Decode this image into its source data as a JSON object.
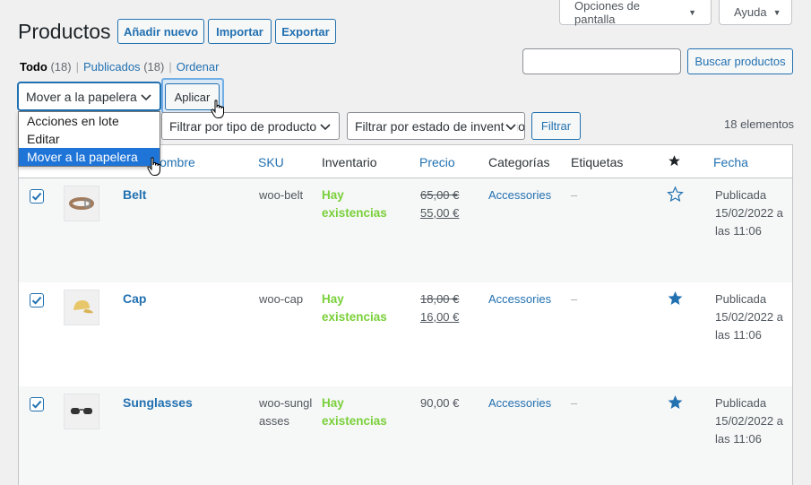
{
  "screen_options": {
    "label": "Opciones de pantalla"
  },
  "help": {
    "label": "Ayuda"
  },
  "page_title": "Productos",
  "title_actions": {
    "add_new": "Añadir nuevo",
    "import": "Importar",
    "export": "Exportar"
  },
  "views": {
    "all": "Todo",
    "all_count": "(18)",
    "published": "Publicados",
    "published_count": "(18)",
    "sort": "Ordenar",
    "sep": "|"
  },
  "search": {
    "value": "",
    "button": "Buscar productos"
  },
  "bulk": {
    "selected": "Mover a la papelera",
    "apply": "Aplicar",
    "options": [
      "Acciones en lote",
      "Editar",
      "Mover a la papelera"
    ]
  },
  "filters": {
    "product_type": "Filtrar por tipo de producto",
    "stock_status": "Filtrar por estado de inventario",
    "button": "Filtrar"
  },
  "items_count": "18 elementos",
  "columns": {
    "name": "Nombre",
    "sku": "SKU",
    "stock": "Inventario",
    "price": "Precio",
    "categories": "Categorías",
    "tags": "Etiquetas",
    "date": "Fecha"
  },
  "rows": [
    {
      "name": "Belt",
      "sku": "woo-belt",
      "stock": "Hay existencias",
      "price_old": "65,00 €",
      "price_new": "55,00 €",
      "category": "Accessories",
      "tags": "–",
      "featured": false,
      "date_status": "Publicada",
      "date": "15/02/2022 a las 11:06",
      "icon": "belt-icon"
    },
    {
      "name": "Cap",
      "sku": "woo-cap",
      "stock": "Hay existencias",
      "price_old": "18,00 €",
      "price_new": "16,00 €",
      "category": "Accessories",
      "tags": "–",
      "featured": true,
      "date_status": "Publicada",
      "date": "15/02/2022 a las 11:06",
      "icon": "cap-icon"
    },
    {
      "name": "Sunglasses",
      "sku": "woo-sunglasses",
      "stock": "Hay existencias",
      "price": "90,00 €",
      "category": "Accessories",
      "tags": "–",
      "featured": true,
      "date_status": "Publicada",
      "date": "15/02/2022 a las 11:06",
      "icon": "sunglasses-icon"
    }
  ],
  "colors": {
    "accent": "#2271b1",
    "in_stock": "#7ad03a",
    "dropdown_highlight": "#1e74d7"
  }
}
